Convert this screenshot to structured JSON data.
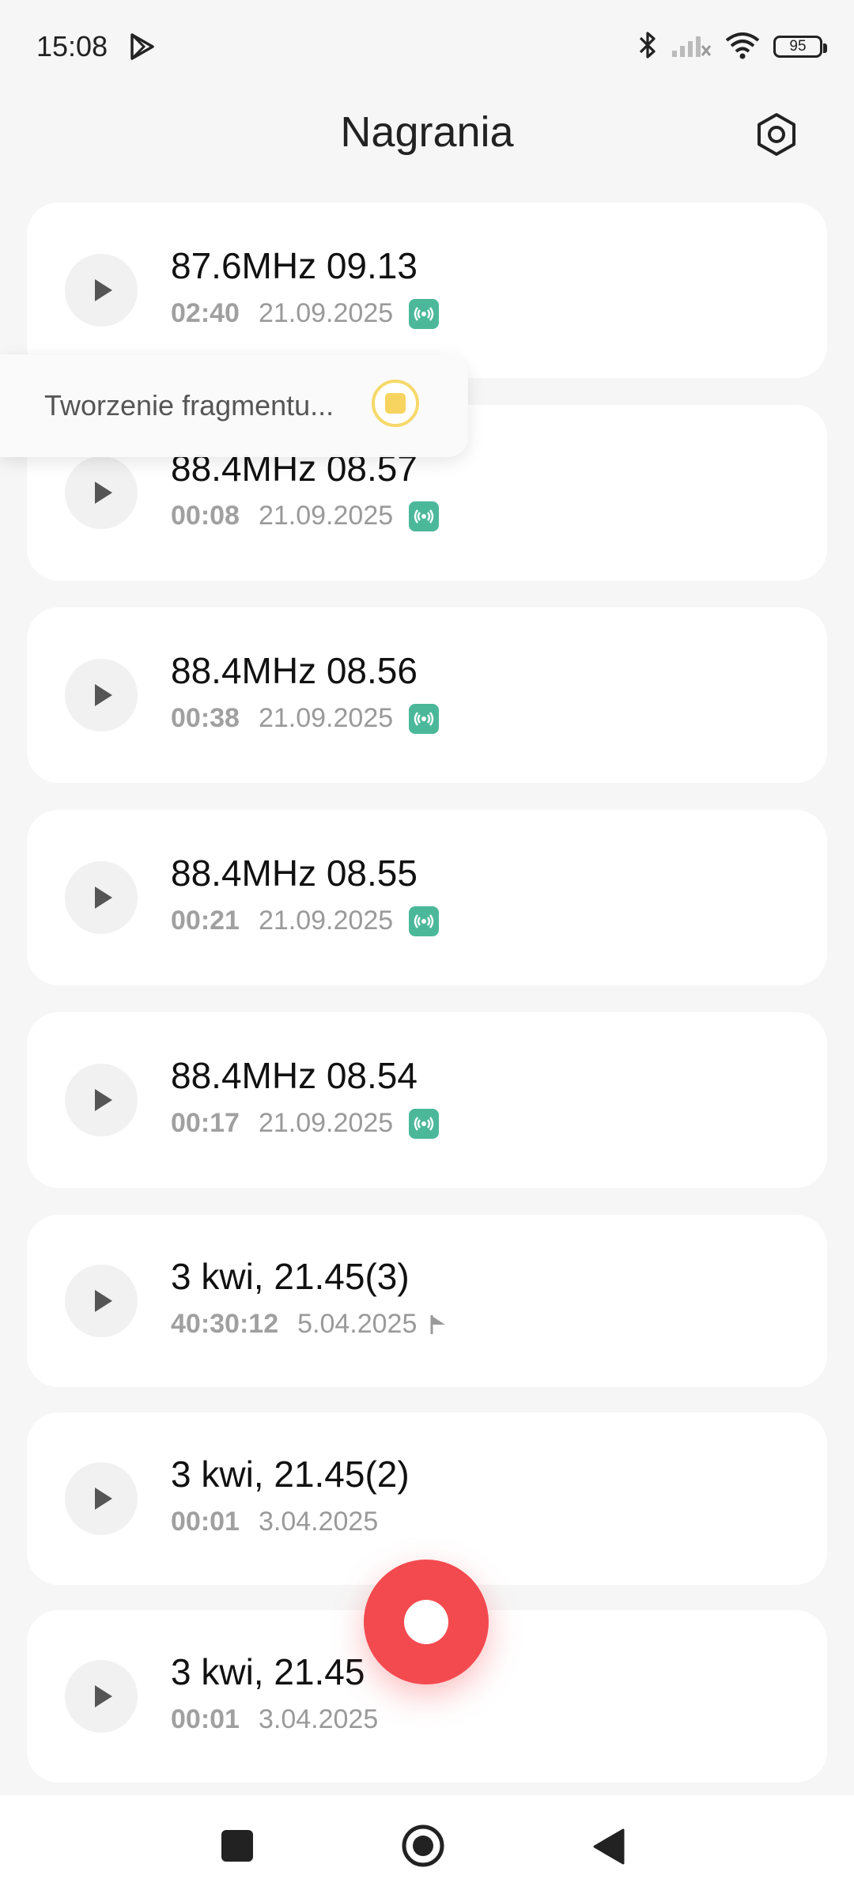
{
  "status_bar": {
    "time": "15:08",
    "battery": "95",
    "icons": [
      "play-store-icon",
      "bluetooth-icon",
      "signal-icon",
      "wifi-icon",
      "battery-icon"
    ]
  },
  "header": {
    "title": "Nagrania",
    "settings_icon": "settings-hexagon-icon"
  },
  "recordings": [
    {
      "title": "87.6MHz 09.13",
      "duration": "02:40",
      "date": "21.09.2025",
      "badge": "radio"
    },
    {
      "title": "88.4MHz 08.57",
      "duration": "00:08",
      "date": "21.09.2025",
      "badge": "radio"
    },
    {
      "title": "88.4MHz 08.56",
      "duration": "00:38",
      "date": "21.09.2025",
      "badge": "radio"
    },
    {
      "title": "88.4MHz 08.55",
      "duration": "00:21",
      "date": "21.09.2025",
      "badge": "radio"
    },
    {
      "title": "88.4MHz 08.54",
      "duration": "00:17",
      "date": "21.09.2025",
      "badge": "radio"
    },
    {
      "title": "3 kwi, 21.45(3)",
      "duration": "40:30:12",
      "date": "5.04.2025",
      "badge": "flag"
    },
    {
      "title": "3 kwi, 21.45(2)",
      "duration": "00:01",
      "date": "3.04.2025",
      "badge": "none"
    },
    {
      "title": "3 kwi, 21.45",
      "duration": "00:01",
      "date": "3.04.2025",
      "badge": "none"
    }
  ],
  "toast": {
    "text": "Tworzenie fragmentu..."
  },
  "colors": {
    "background": "#f6f6f6",
    "card": "#ffffff",
    "radio_badge": "#4cb89a",
    "record_button": "#f34a4f",
    "toast_stop": "#f7d460"
  }
}
